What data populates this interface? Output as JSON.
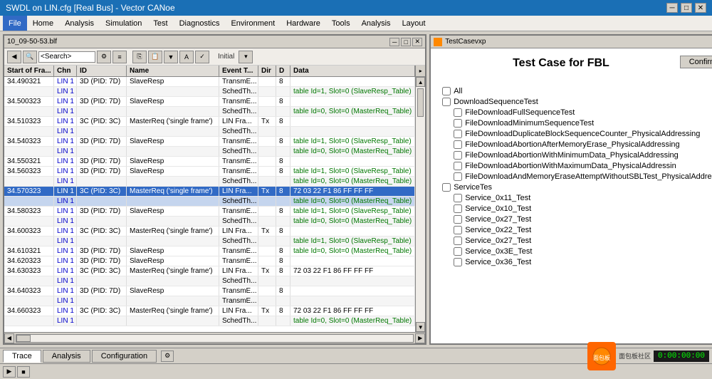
{
  "titleBar": {
    "title": "SWDL on LIN.cfg [Real Bus] - Vector CANoe",
    "minimize": "─",
    "restore": "□",
    "close": "✕"
  },
  "menuBar": {
    "items": [
      "File",
      "Home",
      "Analysis",
      "Simulation",
      "Test",
      "Diagnostics",
      "Environment",
      "Hardware",
      "Tools",
      "Analysis",
      "Layout"
    ]
  },
  "traceWindow": {
    "title": "10_09-50-53.blf",
    "btnMin": "─",
    "btnMax": "□",
    "btnClose": "✕",
    "toolbar": {
      "searchPlaceholder": "<Search>",
      "initialLabel": "Initial"
    },
    "columns": [
      "Start of Fra...",
      "Chn",
      "ID",
      "Name",
      "Event T...",
      "Dir",
      "D",
      "Data"
    ],
    "rows": [
      {
        "time": "34.490321",
        "chn": "LIN 1",
        "id": "3D (PID: 7D)",
        "name": "SlaveResp",
        "event": "TransmE...",
        "dir": "",
        "d": "8",
        "data": "",
        "sub": true
      },
      {
        "time": "34.500323",
        "chn": "LIN 1",
        "id": "3D (PID: 7D)",
        "name": "SlaveResp",
        "event": "TransmE...",
        "dir": "",
        "d": "8",
        "data": "table Id=1, Slot=0 (SlaveResp_Table)",
        "sub": false
      },
      {
        "time": "",
        "chn": "LIN 1",
        "id": "",
        "name": "",
        "event": "SchedTh...",
        "dir": "",
        "d": "",
        "data": "table Id=0, Slot=0 (MasterReq_Table)",
        "sub": true
      },
      {
        "time": "34.510323",
        "chn": "LIN 1",
        "id": "3C (PID: 3C)",
        "name": "MasterReq ('single frame')",
        "event": "LIN Fra...",
        "dir": "Tx",
        "d": "8",
        "data": "",
        "sub": false
      },
      {
        "time": "",
        "chn": "LIN 1",
        "id": "",
        "name": "",
        "event": "SchedTh...",
        "dir": "",
        "d": "",
        "data": "",
        "sub": true
      },
      {
        "time": "34.540323",
        "chn": "LIN 1",
        "id": "3D (PID: 7D)",
        "name": "SlaveResp",
        "event": "TransmE...",
        "dir": "",
        "d": "8",
        "data": "table Id=1, Slot=0 (SlaveResp_Table)",
        "sub": false
      },
      {
        "time": "",
        "chn": "LIN 1",
        "id": "",
        "name": "",
        "event": "SchedTh...",
        "dir": "",
        "d": "",
        "data": "table Id=0, Slot=0 (MasterReq_Table)",
        "sub": true
      },
      {
        "time": "34.550321",
        "chn": "LIN 1",
        "id": "3D (PID: 7D)",
        "name": "SlaveResp",
        "event": "TransmE...",
        "dir": "",
        "d": "8",
        "data": "",
        "sub": false
      },
      {
        "time": "34.560323",
        "chn": "LIN 1",
        "id": "3D (PID: 7D)",
        "name": "SlaveResp",
        "event": "TransmE...",
        "dir": "",
        "d": "8",
        "data": "table Id=1, Slot=0 (SlaveResp_Table)",
        "sub": false
      },
      {
        "time": "",
        "chn": "LIN 1",
        "id": "",
        "name": "",
        "event": "SchedTh...",
        "dir": "",
        "d": "",
        "data": "table Id=0, Slot=0 (MasterReq_Table)",
        "sub": true
      },
      {
        "time": "34.570323",
        "chn": "LIN 1",
        "id": "3C (PID: 3C)",
        "name": "MasterReq ('single frame')",
        "event": "LIN Fra...",
        "dir": "Tx",
        "d": "8",
        "data": "72 03 22 F1 86 FF FF FF",
        "selected": true
      },
      {
        "time": "",
        "chn": "LIN 1",
        "id": "",
        "name": "",
        "event": "SchedTh...",
        "dir": "",
        "d": "",
        "data": "table Id=0, Slot=0 (MasterReq_Table)",
        "sub": true,
        "selected_sub": true
      },
      {
        "time": "34.580323",
        "chn": "LIN 1",
        "id": "3D (PID: 7D)",
        "name": "SlaveResp",
        "event": "TransmE...",
        "dir": "",
        "d": "8",
        "data": "table Id=1, Slot=0 (SlaveResp_Table)",
        "sub": false
      },
      {
        "time": "",
        "chn": "LIN 1",
        "id": "",
        "name": "",
        "event": "SchedTh...",
        "dir": "",
        "d": "",
        "data": "table Id=0, Slot=0 (MasterReq_Table)",
        "sub": true
      },
      {
        "time": "34.600323",
        "chn": "LIN 1",
        "id": "3C (PID: 3C)",
        "name": "MasterReq ('single frame')",
        "event": "LIN Fra...",
        "dir": "Tx",
        "d": "8",
        "data": "",
        "sub": false
      },
      {
        "time": "",
        "chn": "LIN 1",
        "id": "",
        "name": "",
        "event": "SchedTh...",
        "dir": "",
        "d": "",
        "data": "table Id=1, Slot=0 (SlaveResp_Table)",
        "sub": true
      },
      {
        "time": "34.610321",
        "chn": "LIN 1",
        "id": "3D (PID: 7D)",
        "name": "SlaveResp",
        "event": "TransmE...",
        "dir": "",
        "d": "8",
        "data": "table Id=0, Slot=0 (MasterReq_Table)",
        "sub": false
      },
      {
        "time": "34.620323",
        "chn": "LIN 1",
        "id": "3D (PID: 7D)",
        "name": "SlaveResp",
        "event": "TransmE...",
        "dir": "",
        "d": "8",
        "data": "",
        "sub": false
      },
      {
        "time": "34.630323",
        "chn": "LIN 1",
        "id": "3C (PID: 3C)",
        "name": "MasterReq ('single frame')",
        "event": "LIN Fra...",
        "dir": "Tx",
        "d": "8",
        "data": "72 03 22 F1 86 FF FF FF",
        "sub": false
      },
      {
        "time": "",
        "chn": "LIN 1",
        "id": "",
        "name": "",
        "event": "SchedTh...",
        "dir": "",
        "d": "",
        "data": "",
        "sub": true
      },
      {
        "time": "34.640323",
        "chn": "LIN 1",
        "id": "3D (PID: 7D)",
        "name": "SlaveResp",
        "event": "TransmE...",
        "dir": "",
        "d": "8",
        "data": "",
        "sub": false
      },
      {
        "time": "",
        "chn": "LIN 1",
        "id": "",
        "name": "",
        "event": "TransmE...",
        "dir": "",
        "d": "",
        "data": "",
        "sub": true
      },
      {
        "time": "34.660323",
        "chn": "LIN 1",
        "id": "3C (PID: 3C)",
        "name": "MasterReq ('single frame')",
        "event": "LIN Fra...",
        "dir": "Tx",
        "d": "8",
        "data": "72 03 22 F1 86 FF FF FF",
        "sub": false
      },
      {
        "time": "",
        "chn": "LIN 1",
        "id": "",
        "name": "",
        "event": "SchedTh...",
        "dir": "",
        "d": "",
        "data": "table Id=0, Slot=0 (MasterReq_Table)",
        "sub": true
      }
    ]
  },
  "testPanel": {
    "title": "TestCasevxp",
    "heading": "Test Case for FBL",
    "confirmBtn": "Confirm",
    "allLabel": "All",
    "groups": [
      {
        "label": "DownloadSequenceTest",
        "items": [
          "FileDownloadFullSequenceTest",
          "FileDownloadMinimumSequenceTest",
          "FileDownloadDuplicateBlockSequenceCounter_PhysicalAddressing",
          "FileDownloadAbortionAfterMemoryErase_PhysicalAddressing",
          "FileDownloadAbortionWithMinimumData_PhysicalAddressing",
          "FileDownloadAbortionWithMaximumData_PhysicalAddressin",
          "FileDownloadAndMemoryEraseAttemptWithoutSBLTest_PhysicalAddressin"
        ]
      },
      {
        "label": "ServiceTes",
        "items": [
          "Service_0x11_Test",
          "Service_0x10_Test",
          "Service_0x27_Test",
          "Service_0x22_Test",
          "Service_0x27_Test",
          "Service_0x3E_Test",
          "Service_0x36_Test"
        ]
      }
    ]
  },
  "bottomTabs": {
    "tabs": [
      "Trace",
      "Analysis",
      "Configuration"
    ],
    "activeTab": "Trace"
  },
  "statusBar": {
    "time": "0:00:00:00",
    "watermark": "面包板社区"
  }
}
